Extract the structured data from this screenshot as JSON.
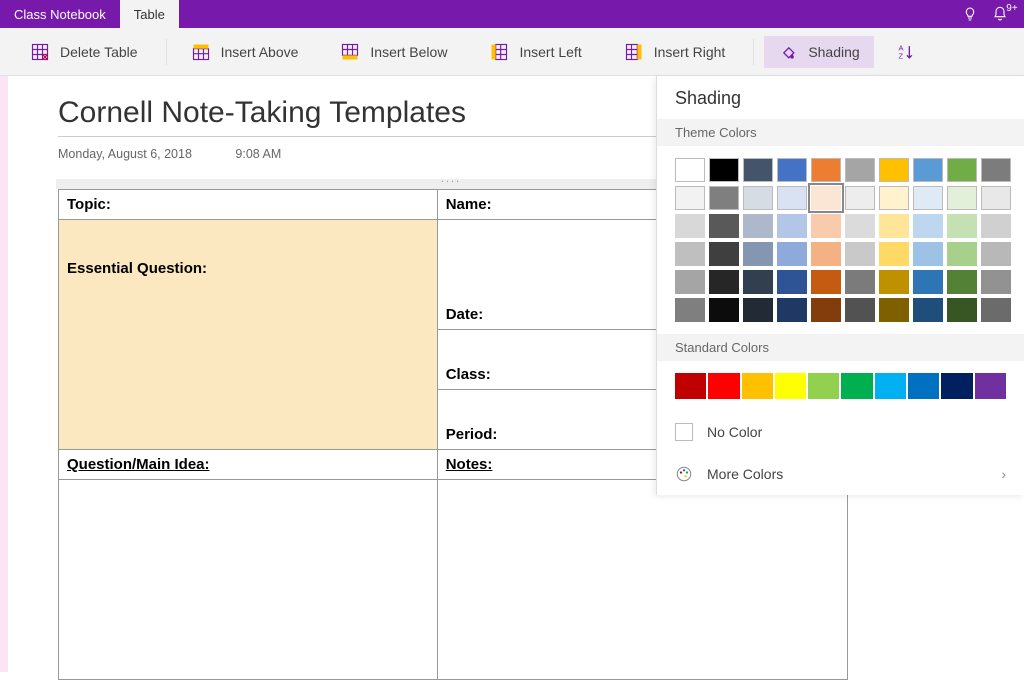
{
  "tabs": {
    "class_notebook": "Class Notebook",
    "table": "Table"
  },
  "titlebar_badge": "9+",
  "ribbon": {
    "delete_table": "Delete Table",
    "insert_above": "Insert Above",
    "insert_below": "Insert Below",
    "insert_left": "Insert Left",
    "insert_right": "Insert Right",
    "shading": "Shading"
  },
  "page": {
    "title": "Cornell Note-Taking Templates",
    "date": "Monday, August 6, 2018",
    "time": "9:08 AM",
    "cells": {
      "topic": "Topic:",
      "name": "Name:",
      "essential_q": "Essential Question:",
      "date": "Date:",
      "class": "Class:",
      "period": "Period:",
      "question_main": "Question/Main Idea:",
      "notes": "Notes:"
    },
    "essential_bg": "#fce8c0"
  },
  "panel": {
    "heading": "Shading",
    "theme_label": "Theme Colors",
    "standard_label": "Standard Colors",
    "no_color": "No Color",
    "more_colors": "More Colors",
    "selected_index": 14,
    "theme_colors": [
      "#ffffff",
      "#000000",
      "#44546a",
      "#4472c4",
      "#ed7d31",
      "#a5a5a5",
      "#ffc000",
      "#5b9bd5",
      "#70ad47",
      "#7c7c7c",
      "#f2f2f2",
      "#7f7f7f",
      "#d6dce4",
      "#d9e2f3",
      "#fbe5d5",
      "#ededed",
      "#fff2cc",
      "#deebf6",
      "#e2efd9",
      "#e8e8e8",
      "#d8d8d8",
      "#595959",
      "#adb9ca",
      "#b4c6e7",
      "#f7cbac",
      "#dbdbdb",
      "#fee599",
      "#bdd7ee",
      "#c5e0b3",
      "#d0d0d0",
      "#bfbfbf",
      "#3f3f3f",
      "#8496b0",
      "#8eaadb",
      "#f4b183",
      "#c9c9c9",
      "#ffd965",
      "#9cc3e5",
      "#a8d08d",
      "#b8b8b8",
      "#a5a5a5",
      "#262626",
      "#323f4f",
      "#2f5496",
      "#c55a11",
      "#7b7b7b",
      "#bf9000",
      "#2e75b5",
      "#538135",
      "#929292",
      "#7f7f7f",
      "#0c0c0c",
      "#222a35",
      "#1f3864",
      "#833c0b",
      "#525252",
      "#7f6000",
      "#1e4e79",
      "#375623",
      "#6b6b6b"
    ],
    "standard_colors": [
      "#c00000",
      "#ff0000",
      "#ffc000",
      "#ffff00",
      "#92d050",
      "#00b050",
      "#00b0f0",
      "#0070c0",
      "#002060",
      "#7030a0"
    ]
  }
}
